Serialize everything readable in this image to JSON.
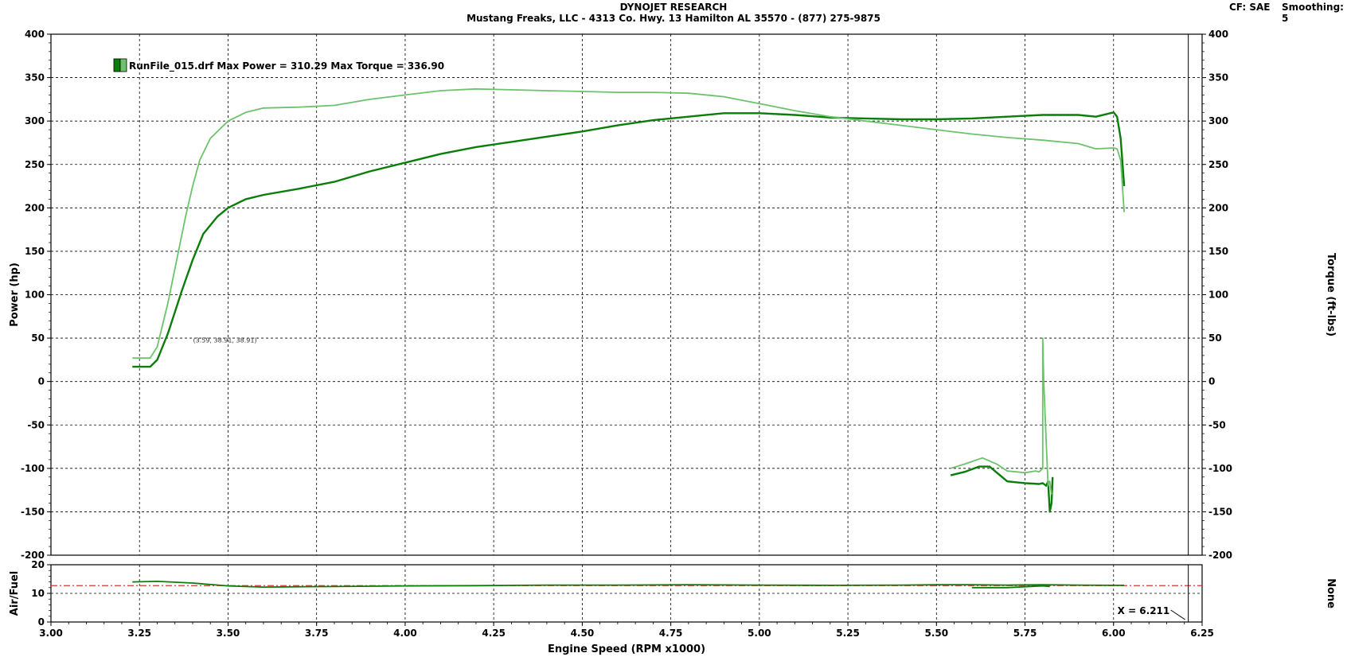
{
  "header": {
    "title": "DYNOJET RESEARCH",
    "subtitle": "Mustang Freaks, LLC - 4313 Co. Hwy. 13 Hamilton AL 35570 - (877) 275-9875",
    "cf_label": "CF: SAE",
    "smoothing_label": "Smoothing: 5"
  },
  "legend": {
    "text": "RunFile_015.drf Max Power = 310.29 Max Torque = 336.90",
    "swatch_dark": "#0a7d0a",
    "swatch_light": "#6cc36c"
  },
  "annotation": "(3.59, 38.91, 38.91)",
  "cursor_readout": "X = 6.211",
  "colors": {
    "power": "#0a7d0a",
    "torque": "#6cc36c",
    "afr_ref": "#e03030",
    "grid": "#000000"
  },
  "chart_data": [
    {
      "type": "line",
      "title": "DYNOJET RESEARCH",
      "xlabel": "Engine Speed (RPM x1000)",
      "ylabel": "Power (hp)",
      "y2label": "Torque (ft-lbs)",
      "xlim": [
        3.0,
        6.25
      ],
      "ylim": [
        -200,
        400
      ],
      "y2lim": [
        -200,
        400
      ],
      "xticks": [
        "3.00",
        "3.25",
        "3.50",
        "3.75",
        "4.00",
        "4.25",
        "4.50",
        "4.75",
        "5.00",
        "5.25",
        "5.50",
        "5.75",
        "6.00",
        "6.25"
      ],
      "yticks": [
        "400",
        "350",
        "300",
        "250",
        "200",
        "150",
        "100",
        "50",
        "0",
        "-50",
        "-100",
        "-150",
        "-200"
      ],
      "grid": true,
      "legend_position": "top-left",
      "series": [
        {
          "name": "Power",
          "axis": "left",
          "color": "#0a7d0a",
          "points": [
            [
              3.23,
              17
            ],
            [
              3.28,
              17
            ],
            [
              3.3,
              25
            ],
            [
              3.33,
              55
            ],
            [
              3.37,
              105
            ],
            [
              3.4,
              140
            ],
            [
              3.43,
              170
            ],
            [
              3.47,
              190
            ],
            [
              3.5,
              200
            ],
            [
              3.55,
              210
            ],
            [
              3.6,
              215
            ],
            [
              3.7,
              222
            ],
            [
              3.8,
              230
            ],
            [
              3.9,
              242
            ],
            [
              4.0,
              252
            ],
            [
              4.1,
              262
            ],
            [
              4.2,
              270
            ],
            [
              4.3,
              276
            ],
            [
              4.4,
              282
            ],
            [
              4.5,
              288
            ],
            [
              4.6,
              295
            ],
            [
              4.7,
              301
            ],
            [
              4.8,
              305
            ],
            [
              4.9,
              309
            ],
            [
              5.0,
              309
            ],
            [
              5.1,
              307
            ],
            [
              5.2,
              304
            ],
            [
              5.3,
              303
            ],
            [
              5.4,
              302
            ],
            [
              5.5,
              302
            ],
            [
              5.6,
              303
            ],
            [
              5.7,
              305
            ],
            [
              5.8,
              307
            ],
            [
              5.9,
              307
            ],
            [
              5.95,
              305
            ],
            [
              6.0,
              310
            ],
            [
              6.01,
              305
            ],
            [
              6.02,
              280
            ],
            [
              6.03,
              225
            ]
          ]
        },
        {
          "name": "Torque",
          "axis": "right",
          "color": "#6cc36c",
          "points": [
            [
              3.23,
              27
            ],
            [
              3.28,
              27
            ],
            [
              3.3,
              40
            ],
            [
              3.33,
              90
            ],
            [
              3.36,
              150
            ],
            [
              3.38,
              190
            ],
            [
              3.4,
              225
            ],
            [
              3.42,
              255
            ],
            [
              3.45,
              280
            ],
            [
              3.5,
              300
            ],
            [
              3.55,
              310
            ],
            [
              3.6,
              315
            ],
            [
              3.7,
              316
            ],
            [
              3.8,
              318
            ],
            [
              3.9,
              325
            ],
            [
              4.0,
              330
            ],
            [
              4.1,
              335
            ],
            [
              4.2,
              337
            ],
            [
              4.3,
              336
            ],
            [
              4.4,
              335
            ],
            [
              4.5,
              334
            ],
            [
              4.6,
              333
            ],
            [
              4.7,
              333
            ],
            [
              4.8,
              332
            ],
            [
              4.9,
              328
            ],
            [
              5.0,
              320
            ],
            [
              5.1,
              312
            ],
            [
              5.2,
              305
            ],
            [
              5.3,
              300
            ],
            [
              5.4,
              295
            ],
            [
              5.5,
              290
            ],
            [
              5.6,
              285
            ],
            [
              5.7,
              281
            ],
            [
              5.8,
              278
            ],
            [
              5.9,
              274
            ],
            [
              5.95,
              268
            ],
            [
              6.0,
              269
            ],
            [
              6.01,
              268
            ],
            [
              6.02,
              255
            ],
            [
              6.03,
              195
            ]
          ]
        },
        {
          "name": "Power (tail)",
          "axis": "left",
          "color": "#0a7d0a",
          "points": [
            [
              5.54,
              -108
            ],
            [
              5.58,
              -104
            ],
            [
              5.62,
              -98
            ],
            [
              5.65,
              -98
            ],
            [
              5.7,
              -115
            ],
            [
              5.75,
              -117
            ],
            [
              5.79,
              -118
            ],
            [
              5.8,
              -117
            ],
            [
              5.81,
              -120
            ],
            [
              5.815,
              -115
            ],
            [
              5.82,
              -150
            ],
            [
              5.825,
              -140
            ],
            [
              5.828,
              -110
            ]
          ]
        },
        {
          "name": "Torque (tail)",
          "axis": "right",
          "color": "#6cc36c",
          "points": [
            [
              5.54,
              -100
            ],
            [
              5.58,
              -95
            ],
            [
              5.63,
              -88
            ],
            [
              5.67,
              -95
            ],
            [
              5.7,
              -103
            ],
            [
              5.75,
              -105
            ],
            [
              5.78,
              -103
            ],
            [
              5.79,
              -104
            ],
            [
              5.8,
              -100
            ],
            [
              5.8,
              50
            ],
            [
              5.803,
              0
            ],
            [
              5.81,
              -70
            ],
            [
              5.815,
              -120
            ],
            [
              5.82,
              -115
            ],
            [
              5.825,
              -130
            ]
          ]
        }
      ]
    },
    {
      "type": "line",
      "ylabel": "Air/Fuel",
      "y2label": "None",
      "xlim": [
        3.0,
        6.25
      ],
      "ylim": [
        0,
        20
      ],
      "yticks": [
        "20",
        "10",
        "0"
      ],
      "reference_line": 12.7,
      "grid": true,
      "series": [
        {
          "name": "Air/Fuel",
          "color": "#0a7d0a",
          "points": [
            [
              3.23,
              14.0
            ],
            [
              3.3,
              14.2
            ],
            [
              3.4,
              13.6
            ],
            [
              3.5,
              12.6
            ],
            [
              3.6,
              12.2
            ],
            [
              3.7,
              12.3
            ],
            [
              3.8,
              12.4
            ],
            [
              3.9,
              12.5
            ],
            [
              4.0,
              12.6
            ],
            [
              4.2,
              12.7
            ],
            [
              4.4,
              12.9
            ],
            [
              4.6,
              12.9
            ],
            [
              4.8,
              13.0
            ],
            [
              5.0,
              12.9
            ],
            [
              5.2,
              12.8
            ],
            [
              5.4,
              12.9
            ],
            [
              5.5,
              13.0
            ],
            [
              5.6,
              13.0
            ],
            [
              5.7,
              12.9
            ],
            [
              5.8,
              13.0
            ],
            [
              5.9,
              12.9
            ],
            [
              6.0,
              12.8
            ],
            [
              6.03,
              12.8
            ]
          ]
        },
        {
          "name": "Air/Fuel (tail)",
          "color": "#0a7d0a",
          "points": [
            [
              5.6,
              12.0
            ],
            [
              5.7,
              12.0
            ],
            [
              5.8,
              12.6
            ],
            [
              5.82,
              12.4
            ]
          ]
        }
      ]
    }
  ]
}
